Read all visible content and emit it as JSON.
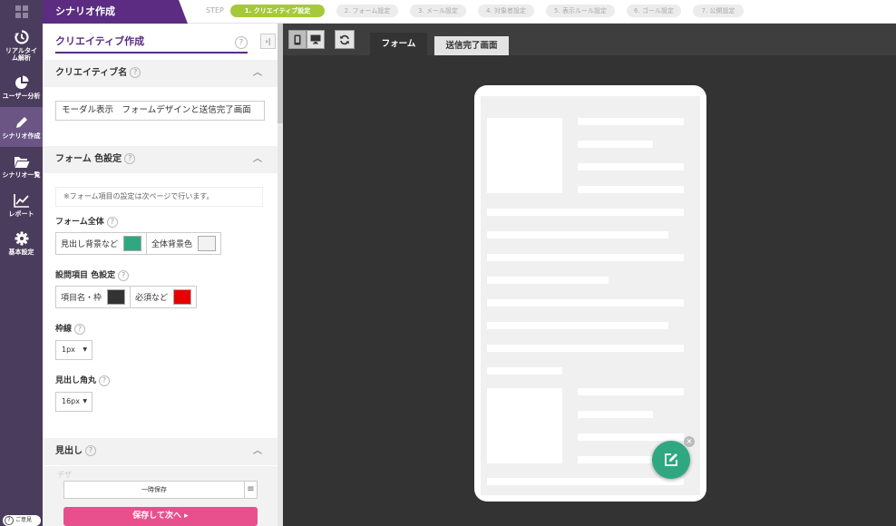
{
  "app": {
    "title": "シナリオ作成"
  },
  "steps": {
    "label": "STEP",
    "items": [
      {
        "label": "1. クリエイティブ設定"
      },
      {
        "label": "2. フォーム設定"
      },
      {
        "label": "3. メール設定"
      },
      {
        "label": "4. 対象者設定"
      },
      {
        "label": "5. 表示ルール設定"
      },
      {
        "label": "6. ゴール設定"
      },
      {
        "label": "7. 公開設定"
      }
    ]
  },
  "nav": {
    "items": [
      {
        "label": "リアルタイム解析"
      },
      {
        "label": "ユーザー分析"
      },
      {
        "label": "シナリオ作成"
      },
      {
        "label": "シナリオ一覧"
      },
      {
        "label": "レポート"
      },
      {
        "label": "基本設定"
      }
    ],
    "help": "ご意見"
  },
  "panel": {
    "title": "クリエイティブ作成",
    "help": "?",
    "collapse": "›|",
    "sections": {
      "name": {
        "title": "クリエイティブ名",
        "value": "モーダル表示　フォームデザインと送信完了画面"
      },
      "form_color": {
        "title": "フォーム 色設定",
        "note": "※フォーム項目の設定は次ページで行います。",
        "form_all": {
          "label": "フォーム全体",
          "heading_bg": "見出し背景など",
          "all_bg": "全体背景色"
        },
        "question": {
          "label": "設問項目 色設定",
          "name_frame": "項目名・枠",
          "required": "必須など"
        },
        "border": {
          "label": "枠線",
          "value": "1px"
        },
        "radius": {
          "label": "見出し角丸",
          "value": "16px"
        }
      },
      "heading": {
        "title": "見出し",
        "behind_text": "デザ"
      }
    },
    "buttons": {
      "temp_save": "一時保存",
      "menu": "≡",
      "save_next": "保存して次へ ▸"
    }
  },
  "preview": {
    "tabs": [
      {
        "label": "フォーム"
      },
      {
        "label": "送信完了画面"
      }
    ],
    "fab_close": "×"
  },
  "colors": {
    "accent": "#5b2c82",
    "nav_bg": "#4a3c5c",
    "step_active": "#a6c93b",
    "heading_bg_swatch": "#2fa882",
    "all_bg_swatch": "#f2f2f2",
    "name_frame_swatch": "#333333",
    "required_swatch": "#e60000",
    "save_next": "#e8508d"
  }
}
